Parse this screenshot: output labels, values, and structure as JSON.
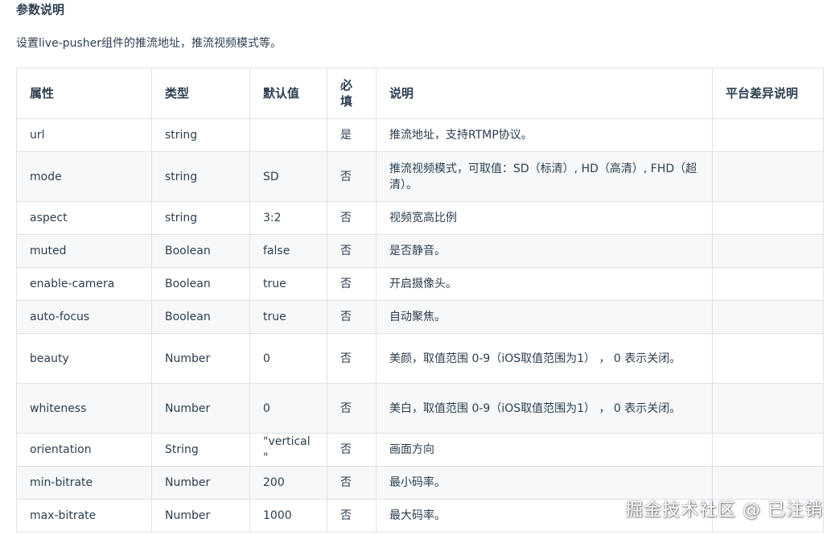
{
  "section": {
    "title": "参数说明",
    "description": "设置live-pusher组件的推流地址，推流视频模式等。"
  },
  "table": {
    "headers": [
      "属性",
      "类型",
      "默认值",
      "必填",
      "说明",
      "平台差异说明"
    ],
    "rows": [
      [
        "url",
        "string",
        "",
        "是",
        "推流地址，支持RTMP协议。",
        ""
      ],
      [
        "mode",
        "string",
        "SD",
        "否",
        "推流视频模式，可取值：SD（标清）, HD（高清）, FHD（超清）。",
        ""
      ],
      [
        "aspect",
        "string",
        "3:2",
        "否",
        "视频宽高比例",
        ""
      ],
      [
        "muted",
        "Boolean",
        "false",
        "否",
        "是否静音。",
        ""
      ],
      [
        "enable-camera",
        "Boolean",
        "true",
        "否",
        "开启摄像头。",
        ""
      ],
      [
        "auto-focus",
        "Boolean",
        "true",
        "否",
        "自动聚焦。",
        ""
      ],
      [
        "beauty",
        "Number",
        "0",
        "否",
        "美颜，取值范围 0-9（iOS取值范围为1） ， 0 表示关闭。",
        ""
      ],
      [
        "whiteness",
        "Number",
        "0",
        "否",
        "美白，取值范围 0-9（iOS取值范围为1） ， 0 表示关闭。",
        ""
      ],
      [
        "orientation",
        "String",
        "\"vertical\"",
        "否",
        "画面方向",
        ""
      ],
      [
        "min-bitrate",
        "Number",
        "200",
        "否",
        "最小码率。",
        ""
      ],
      [
        "max-bitrate",
        "Number",
        "1000",
        "否",
        "最大码率。",
        ""
      ]
    ]
  },
  "watermark": "掘金技术社区 @ 已注销"
}
